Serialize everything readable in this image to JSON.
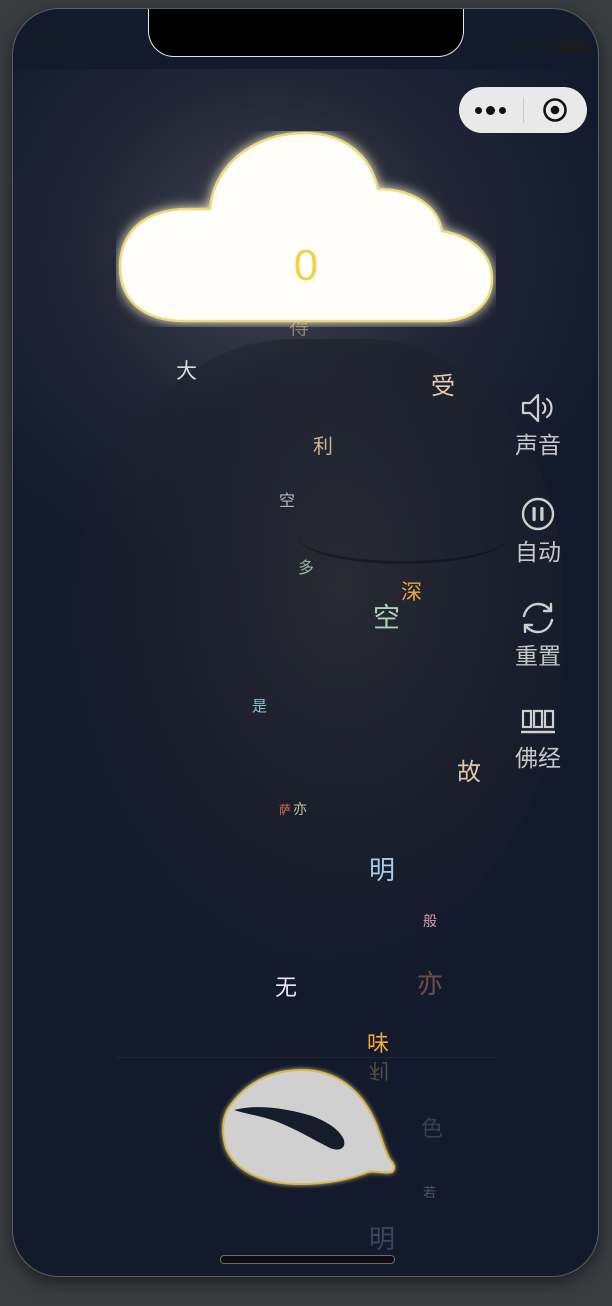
{
  "status_bar": {
    "time": "21:31",
    "battery_percent": "100%"
  },
  "counter": "0",
  "side_menu": {
    "sound": {
      "label": "声音",
      "icon": "speaker-icon"
    },
    "auto": {
      "label": "自动",
      "icon": "pause-circle-icon"
    },
    "reset": {
      "label": "重置",
      "icon": "refresh-icon"
    },
    "sutra": {
      "label": "佛经",
      "icon": "sutra-icon"
    }
  },
  "falling_chars": [
    {
      "text": "大",
      "color": "#dcdcdc"
    },
    {
      "text": "受",
      "color": "#e7ccb3"
    },
    {
      "text": "利",
      "color": "#c9b48f"
    },
    {
      "text": "空",
      "color": "#b8b8b8"
    },
    {
      "text": "多",
      "color": "#9eb3a0"
    },
    {
      "text": "深",
      "color": "#f0a640"
    },
    {
      "text": "空",
      "color": "#a9d3b4"
    },
    {
      "text": "是",
      "color": "#87c3cc"
    },
    {
      "text": "故",
      "color": "#e2c6a7"
    },
    {
      "text": "萨",
      "color": "#e07042"
    },
    {
      "text": "亦",
      "color": "#bfc3a2"
    },
    {
      "text": "明",
      "color": "#a6ccea"
    },
    {
      "text": "般",
      "color": "#d6a2b4"
    },
    {
      "text": "无",
      "color": "#ece6f5"
    },
    {
      "text": "亦",
      "color": "#8f6050"
    },
    {
      "text": "味",
      "color": "#f0a83c"
    },
    {
      "text": "利",
      "color": "#8a7a55"
    },
    {
      "text": "色",
      "color": "#5d6666"
    },
    {
      "text": "若",
      "color": "#6f6e72"
    },
    {
      "text": "明",
      "color": "#4b5f77"
    },
    {
      "text": "得",
      "color": "#c2a48d"
    }
  ]
}
